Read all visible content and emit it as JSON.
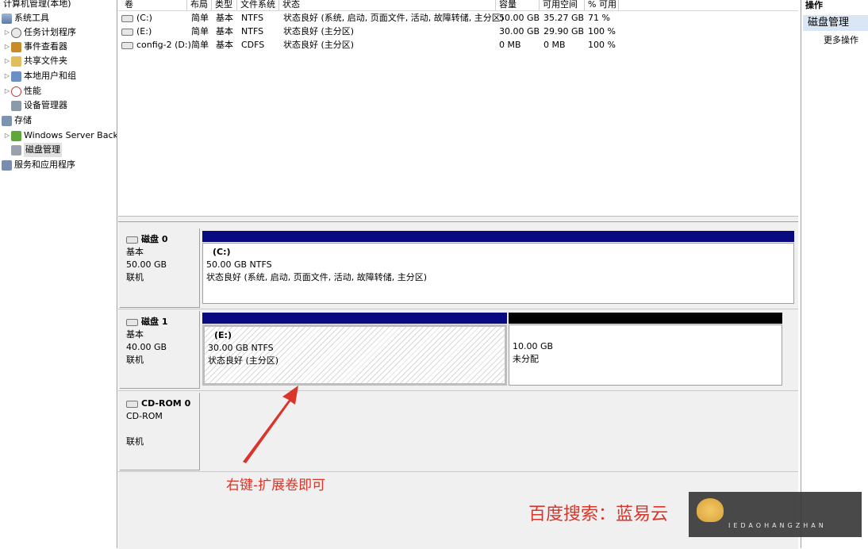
{
  "tree": {
    "root": "计算机管理(本地)",
    "items": [
      {
        "label": "系统工具",
        "icon": "tools-icon",
        "expander": "",
        "indent": 0
      },
      {
        "label": "任务计划程序",
        "icon": "clock-icon",
        "expander": "▷",
        "indent": 1
      },
      {
        "label": "事件查看器",
        "icon": "event-viewer-icon",
        "expander": "▷",
        "indent": 1
      },
      {
        "label": "共享文件夹",
        "icon": "shared-folder-icon",
        "expander": "▷",
        "indent": 1
      },
      {
        "label": "本地用户和组",
        "icon": "users-icon",
        "expander": "▷",
        "indent": 1
      },
      {
        "label": "性能",
        "icon": "performance-icon",
        "expander": "▷",
        "indent": 1
      },
      {
        "label": "设备管理器",
        "icon": "device-manager-icon",
        "expander": "",
        "indent": 1
      },
      {
        "label": "存储",
        "icon": "storage-icon",
        "expander": "",
        "indent": 0
      },
      {
        "label": "Windows Server Back",
        "icon": "windows-server-backup-icon",
        "expander": "▷",
        "indent": 1
      },
      {
        "label": "磁盘管理",
        "icon": "disk-management-icon",
        "expander": "",
        "indent": 1,
        "selected": true
      },
      {
        "label": "服务和应用程序",
        "icon": "services-icon",
        "expander": "",
        "indent": 0
      }
    ]
  },
  "volumes": {
    "headers": [
      "卷",
      "布局",
      "类型",
      "文件系统",
      "状态",
      "容量",
      "可用空间",
      "% 可用"
    ],
    "rows": [
      [
        "(C:)",
        "简单",
        "基本",
        "NTFS",
        "状态良好 (系统, 启动, 页面文件, 活动, 故障转储, 主分区)",
        "50.00 GB",
        "35.27 GB",
        "71 %"
      ],
      [
        "(E:)",
        "简单",
        "基本",
        "NTFS",
        "状态良好 (主分区)",
        "30.00 GB",
        "29.90 GB",
        "100 %"
      ],
      [
        "config-2 (D:)",
        "简单",
        "基本",
        "CDFS",
        "状态良好 (主分区)",
        "0 MB",
        "0 MB",
        "100 %"
      ]
    ]
  },
  "actions": {
    "title": "操作",
    "section": "磁盘管理",
    "more": "更多操作"
  },
  "disks": [
    {
      "name": "磁盘 0",
      "type": "基本",
      "size": "50.00 GB",
      "status": "联机",
      "partitions": [
        {
          "name": "(C:)",
          "line1": "50.00 GB NTFS",
          "line2": "状态良好 (系统, 启动, 页面文件, 活动, 故障转储, 主分区)"
        }
      ]
    },
    {
      "name": "磁盘 1",
      "type": "基本",
      "size": "40.00 GB",
      "status": "联机",
      "partitions": [
        {
          "name": "(E:)",
          "line1": "30.00 GB NTFS",
          "line2": "状态良好 (主分区)"
        },
        {
          "name": "",
          "line1": "10.00 GB",
          "line2": "未分配"
        }
      ]
    },
    {
      "name": "CD-ROM 0",
      "type": "CD-ROM",
      "size": "",
      "status": "联机"
    }
  ],
  "annotations": {
    "arrow_text": "右键-扩展卷即可",
    "search_text": "百度搜索：蓝易云",
    "watermark_text": "IEDAOHANGZHAN"
  },
  "colors": {
    "primary_bar": "#0a0a80",
    "unallocated_bar": "#000000",
    "annotation": "#d9352a"
  }
}
